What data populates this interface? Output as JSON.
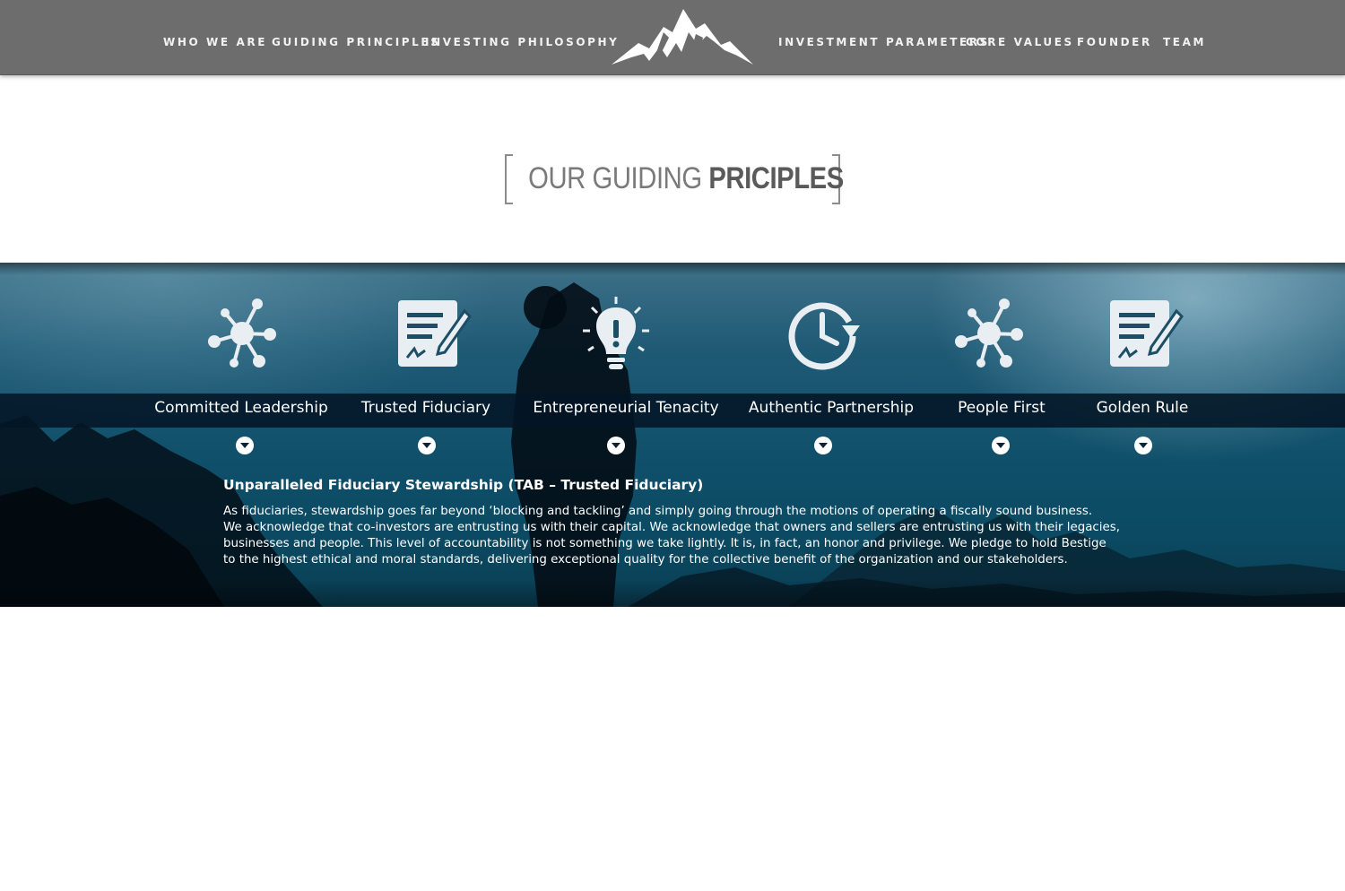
{
  "nav": {
    "left": [
      "WHO WE ARE",
      "GUIDING PRINCIPLES",
      "INVESTING PHILOSOPHY"
    ],
    "right": [
      "INVESTMENT PARAMETERS",
      "CORE VALUES",
      "FOUNDER",
      "TEAM"
    ]
  },
  "section": {
    "title_light": "OUR GUIDING ",
    "title_bold": "PRICIPLES"
  },
  "pillars": [
    {
      "label": "Committed Leadership",
      "icon": "network-icon"
    },
    {
      "label": "Trusted Fiduciary",
      "icon": "document-signature-icon"
    },
    {
      "label": "Entrepreneurial Tenacity",
      "icon": "lightbulb-icon"
    },
    {
      "label": "Authentic Partnership",
      "icon": "clock-icon"
    },
    {
      "label": "People First",
      "icon": "network-icon"
    },
    {
      "label": "Golden Rule",
      "icon": "document-signature-icon"
    }
  ],
  "content": {
    "title": "Unparalleled Fiduciary Stewardship (TAB – Trusted Fiduciary)",
    "lines": [
      "As fiduciaries, stewardship goes far beyond ‘blocking and tackling’ and simply going through the motions of operating a fiscally sound business.",
      "We acknowledge that co-investors are entrusting us with their capital.  We acknowledge that owners and sellers are entrusting us with their legacies,",
      "businesses and people.  This level of accountability is not something we take lightly.  It is, in fact, an honor and privilege.  We pledge to hold Bestige",
      "to the highest ethical and moral standards, delivering exceptional quality for the collective benefit of the organization and our stakeholders."
    ]
  },
  "colors": {
    "nav_bg": "#6d6d6d",
    "strip_bg": "#031626",
    "hero_teal": "#11506b"
  }
}
